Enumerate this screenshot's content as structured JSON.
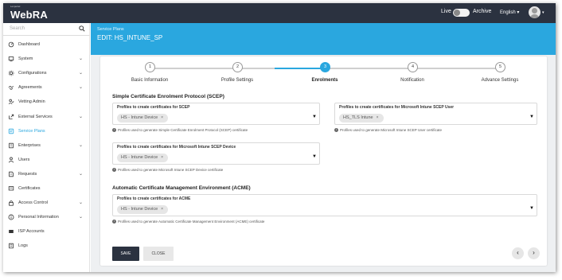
{
  "topbar": {
    "brand_small": "Lexpertel",
    "brand_name": "WebRA",
    "live_label": "Live",
    "archive_label": "Archive",
    "language": "English ▾",
    "avatar_caret": "▾"
  },
  "sidebar": {
    "search_placeholder": "Search",
    "items": [
      {
        "label": "Dashboard",
        "icon": "dashboard-icon",
        "chevron": ""
      },
      {
        "label": "System",
        "icon": "system-icon",
        "chevron": "⌄"
      },
      {
        "label": "Configurations",
        "icon": "gear-icon",
        "chevron": "⌄"
      },
      {
        "label": "Agreements",
        "icon": "handshake-icon",
        "chevron": "⌄"
      },
      {
        "label": "Vetting Admin",
        "icon": "person-check-icon",
        "chevron": ""
      },
      {
        "label": "External Services",
        "icon": "external-icon",
        "chevron": "⌄"
      },
      {
        "label": "Service Plans",
        "icon": "plans-icon",
        "chevron": ""
      },
      {
        "label": "Enterprises",
        "icon": "building-icon",
        "chevron": "⌄"
      },
      {
        "label": "Users",
        "icon": "user-icon",
        "chevron": ""
      },
      {
        "label": "Requests",
        "icon": "requests-icon",
        "chevron": "⌄"
      },
      {
        "label": "Certificates",
        "icon": "certificate-icon",
        "chevron": ""
      },
      {
        "label": "Access Control",
        "icon": "lock-icon",
        "chevron": "⌄"
      },
      {
        "label": "Personal Information",
        "icon": "info-icon",
        "chevron": "⌄"
      },
      {
        "label": "ISP Accounts",
        "icon": "isp-icon",
        "chevron": ""
      },
      {
        "label": "Logs",
        "icon": "logs-icon",
        "chevron": ""
      }
    ],
    "active_item": "Service Plans"
  },
  "page": {
    "breadcrumb": "Service Plans",
    "title": "EDIT: HS_INTUNE_SP"
  },
  "steps": [
    {
      "num": "1",
      "label": "Basic Information"
    },
    {
      "num": "2",
      "label": "Profile Settings"
    },
    {
      "num": "3",
      "label": "Enrolments"
    },
    {
      "num": "4",
      "label": "Notification"
    },
    {
      "num": "5",
      "label": "Advance Settings"
    }
  ],
  "active_step": "3",
  "scep": {
    "section_title": "Simple Certificate Enrolment Protocol (SCEP)",
    "scep_field": {
      "label": "Profiles to create certificates for SCEP",
      "chip": "HS - Intune Device",
      "hint": "Profiles used to generate Simple Certificate Enrolment Protocol (SCEP) certificate"
    },
    "ms_field": {
      "label": "Profiles to create certificates for Microsoft Intune SCEP User",
      "chip": "HS_TLS Intune",
      "hint": "Profiles used to generate Microsoft Intune SCEP User certificate"
    },
    "device_field": {
      "label": "Profiles to create certificates for Microsoft Intune SCEP Device",
      "chip": "HS - Intune Device",
      "hint": "Profiles used to generate Microsoft Intune SCEP Device certificate"
    }
  },
  "acme": {
    "section_title": "Automatic Certificate Management Environment (ACME)",
    "field": {
      "label": "Profiles to create certificates for ACME",
      "chip": "HS - Intune Device",
      "hint": "Profiles used to generate Automatic Certificate Management Environment (ACME) certificate"
    }
  },
  "buttons": {
    "save": "SAVE",
    "close": "CLOSE",
    "prev": "‹",
    "next": "›"
  },
  "chip_remove": "×",
  "dropdown_caret": "▼",
  "info_glyph": "i",
  "colors": {
    "topbar": "#2b3240",
    "accent": "#2aa7df",
    "content_bg": "#eef0f2"
  }
}
